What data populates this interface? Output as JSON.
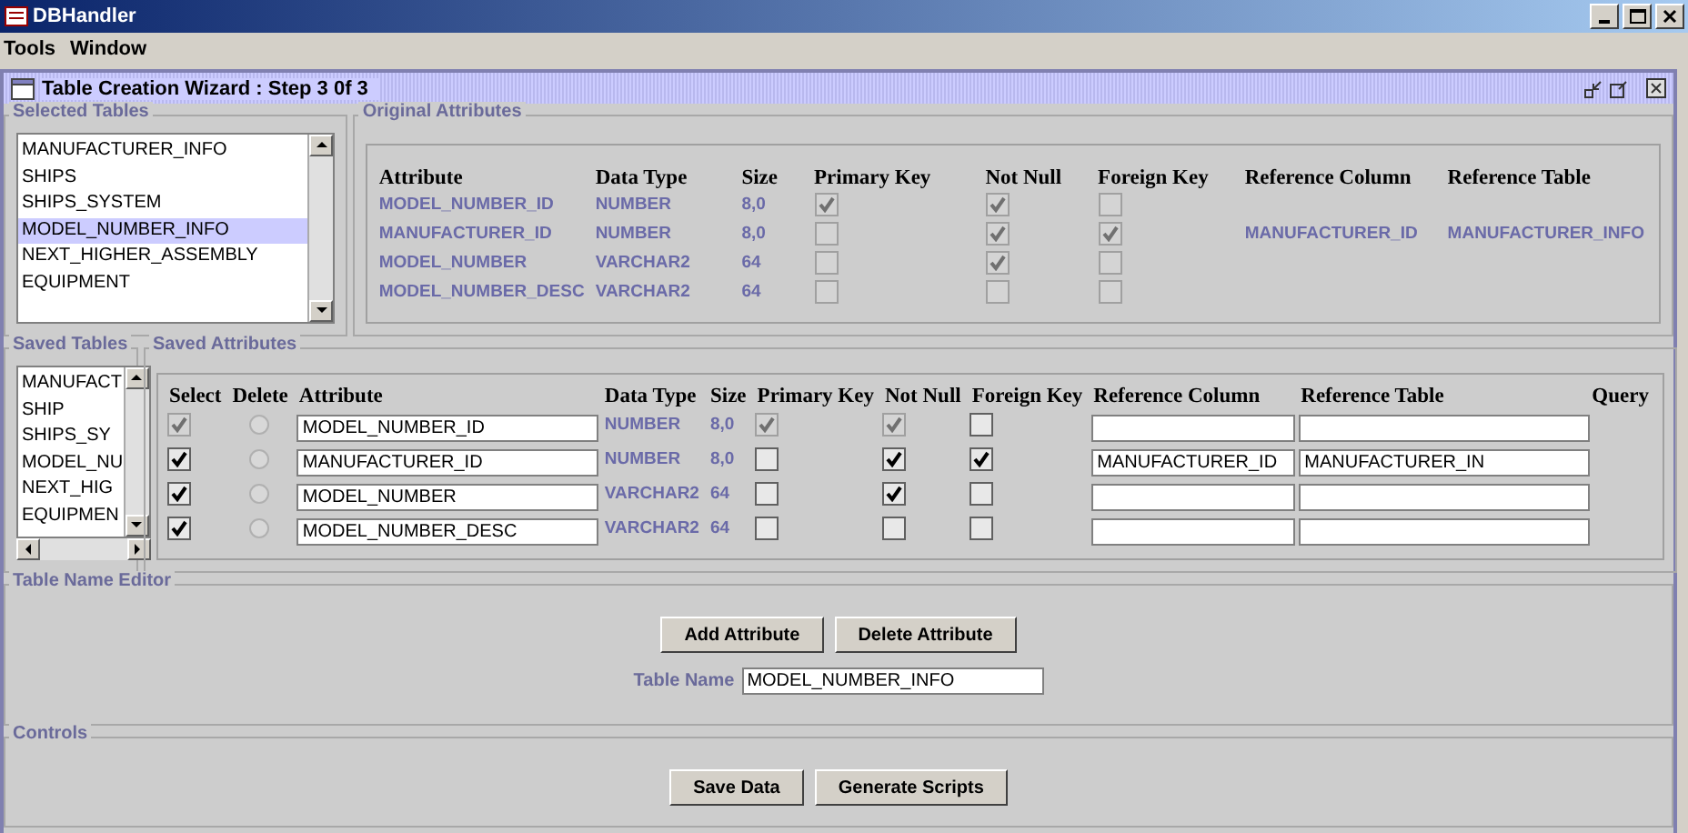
{
  "window": {
    "title": "DBHandler"
  },
  "menu": [
    "Tools",
    "Window"
  ],
  "frame": {
    "title": "Table Creation Wizard : Step 3 0f 3"
  },
  "selected_tables": {
    "title": "Selected Tables",
    "items": [
      {
        "label": "MANUFACTURER_INFO",
        "selected": false
      },
      {
        "label": "SHIPS",
        "selected": false
      },
      {
        "label": "SHIPS_SYSTEM",
        "selected": false
      },
      {
        "label": "MODEL_NUMBER_INFO",
        "selected": true
      },
      {
        "label": "NEXT_HIGHER_ASSEMBLY",
        "selected": false
      },
      {
        "label": "EQUIPMENT",
        "selected": false
      }
    ]
  },
  "original_attributes": {
    "title": "Original Attributes",
    "columns": [
      "Attribute",
      "Data Type",
      "Size",
      "Primary Key",
      "Not Null",
      "Foreign Key",
      "Reference Column",
      "Reference Table"
    ],
    "rows": [
      {
        "attribute": "MODEL_NUMBER_ID",
        "data_type": "NUMBER",
        "size": "8,0",
        "primary_key": true,
        "not_null": true,
        "foreign_key": false
      },
      {
        "attribute": "MANUFACTURER_ID",
        "data_type": "NUMBER",
        "size": "8,0",
        "primary_key": false,
        "not_null": true,
        "foreign_key": true,
        "reference_column": "MANUFACTURER_ID",
        "reference_table": "MANUFACTURER_INFO"
      },
      {
        "attribute": "MODEL_NUMBER",
        "data_type": "VARCHAR2",
        "size": "64",
        "primary_key": false,
        "not_null": true,
        "foreign_key": false
      },
      {
        "attribute": "MODEL_NUMBER_DESC",
        "data_type": "VARCHAR2",
        "size": "64",
        "primary_key": false,
        "not_null": false,
        "foreign_key": false
      }
    ]
  },
  "saved_tables": {
    "title": "Saved Tables",
    "items": [
      {
        "label": "MANUFACT",
        "selected": false
      },
      {
        "label": "SHIP",
        "selected": false
      },
      {
        "label": "SHIPS_SY",
        "selected": false
      },
      {
        "label": "MODEL_NU",
        "selected": false
      },
      {
        "label": "NEXT_HIG",
        "selected": false
      },
      {
        "label": "EQUIPMEN",
        "selected": false
      }
    ]
  },
  "saved_attributes": {
    "title": "Saved Attributes",
    "columns": [
      "Select",
      "Delete",
      "Attribute",
      "Data Type",
      "Size",
      "Primary Key",
      "Not Null",
      "Foreign Key",
      "Reference Column",
      "Reference Table",
      "Query"
    ],
    "rows": [
      {
        "select": {
          "checked": true,
          "disabled": true
        },
        "delete": false,
        "attribute": "MODEL_NUMBER_ID",
        "data_type": "NUMBER",
        "size": "8,0",
        "primary_key": {
          "checked": true,
          "disabled": true
        },
        "not_null": {
          "checked": true,
          "disabled": true
        },
        "foreign_key": {
          "checked": false,
          "disabled": false
        }
      },
      {
        "select": {
          "checked": true,
          "disabled": false
        },
        "delete": false,
        "attribute": "MANUFACTURER_ID",
        "data_type": "NUMBER",
        "size": "8,0",
        "primary_key": {
          "checked": false,
          "disabled": false
        },
        "not_null": {
          "checked": true,
          "disabled": false
        },
        "foreign_key": {
          "checked": true,
          "disabled": false
        },
        "reference_column": "MANUFACTURER_ID",
        "reference_table": "MANUFACTURER_IN"
      },
      {
        "select": {
          "checked": true,
          "disabled": false
        },
        "delete": false,
        "attribute": "MODEL_NUMBER",
        "data_type": "VARCHAR2",
        "size": "64",
        "primary_key": {
          "checked": false,
          "disabled": false
        },
        "not_null": {
          "checked": true,
          "disabled": false
        },
        "foreign_key": {
          "checked": false,
          "disabled": false
        }
      },
      {
        "select": {
          "checked": true,
          "disabled": false
        },
        "delete": false,
        "attribute": "MODEL_NUMBER_DESC",
        "data_type": "VARCHAR2",
        "size": "64",
        "primary_key": {
          "checked": false,
          "disabled": false
        },
        "not_null": {
          "checked": false,
          "disabled": false
        },
        "foreign_key": {
          "checked": false,
          "disabled": false
        }
      }
    ]
  },
  "table_name_editor": {
    "title": "Table Name Editor",
    "buttons": [
      "Add Attribute",
      "Delete Attribute"
    ],
    "label": "Table Name",
    "value": "MODEL_NUMBER_INFO"
  },
  "controls": {
    "title": "Controls",
    "buttons": [
      "Save Data",
      "Generate Scripts"
    ]
  }
}
